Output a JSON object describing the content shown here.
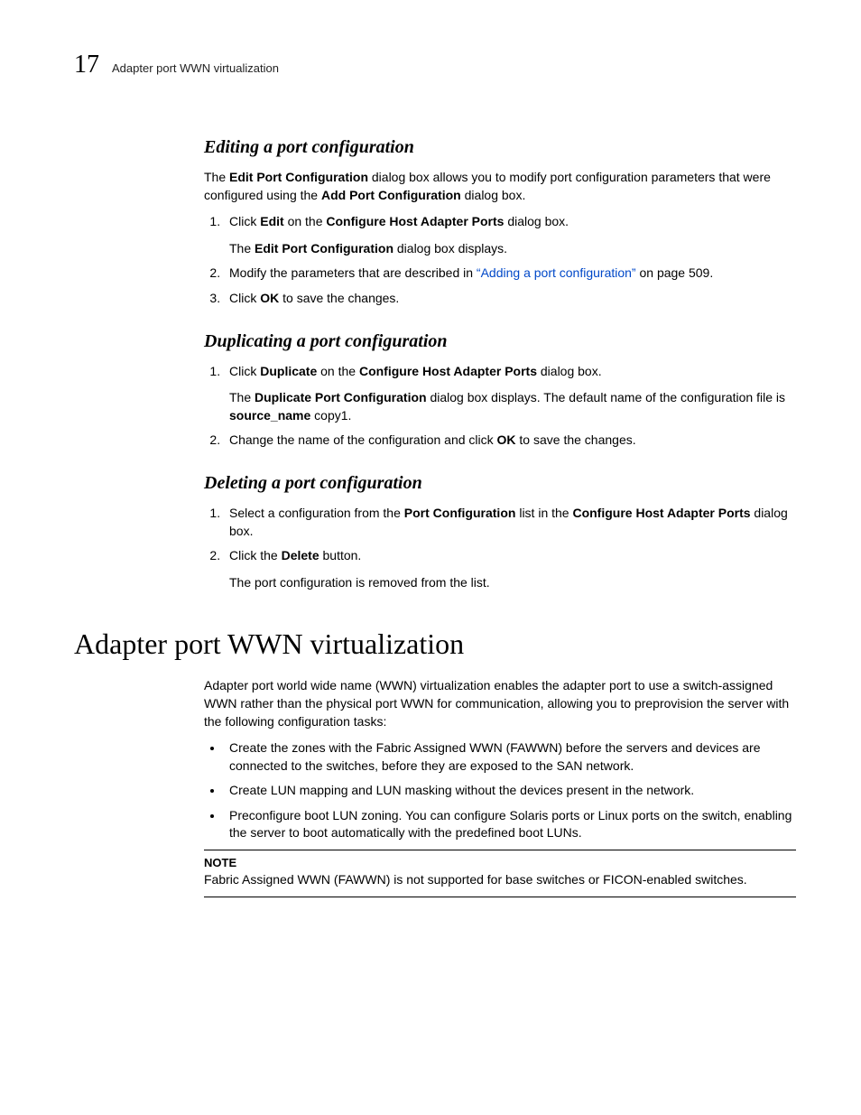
{
  "header": {
    "chapter_number": "17",
    "running_title": "Adapter port WWN virtualization"
  },
  "sec_edit": {
    "title": "Editing a port configuration",
    "intro": {
      "pre1": "The ",
      "b1": "Edit Port Configuration",
      "mid1": " dialog box allows you to modify port configuration parameters that were configured using the ",
      "b2": "Add Port Configuration",
      "post1": " dialog box."
    },
    "step1": {
      "pre": "Click ",
      "b1": "Edit",
      "mid": " on the ",
      "b2": "Configure Host Adapter Ports",
      "post": " dialog box.",
      "sub_pre": "The ",
      "sub_b": "Edit Port Configuration",
      "sub_post": " dialog box displays."
    },
    "step2": {
      "pre": "Modify the parameters that are described in ",
      "link": "“Adding a port configuration”",
      "post": " on page 509."
    },
    "step3": {
      "pre": "Click ",
      "b1": "OK",
      "post": " to save the changes."
    }
  },
  "sec_dup": {
    "title": "Duplicating a port configuration",
    "step1": {
      "pre": "Click ",
      "b1": "Duplicate",
      "mid": " on the ",
      "b2": "Configure Host Adapter Ports",
      "post": " dialog box.",
      "sub_pre": "The ",
      "sub_b1": "Duplicate Port Configuration",
      "sub_mid": " dialog box displays. The default name of the configuration file is ",
      "sub_b2": "source_name",
      "sub_post": " copy1."
    },
    "step2": {
      "pre": "Change the name of the configuration and click ",
      "b1": "OK",
      "post": " to save the changes."
    }
  },
  "sec_del": {
    "title": "Deleting a port configuration",
    "step1": {
      "pre": "Select a configuration from the ",
      "b1": "Port Configuration",
      "mid": " list in the ",
      "b2": "Configure Host Adapter Ports",
      "post": " dialog box."
    },
    "step2": {
      "pre": "Click the ",
      "b1": "Delete",
      "post": " button.",
      "sub": "The port configuration is removed from the list."
    }
  },
  "h1": "Adapter port WWN virtualization",
  "wwn_intro": "Adapter port world wide name (WWN) virtualization enables the adapter port to use a switch-assigned WWN rather than the physical port WWN for communication, allowing you to preprovision the server with the following configuration tasks:",
  "wwn_bullets": {
    "b1": "Create the zones with the Fabric Assigned WWN (FAWWN) before the servers and devices are connected to the switches, before they are exposed to the SAN network.",
    "b2": "Create LUN mapping and LUN masking without the devices present in the network.",
    "b3": "Preconfigure boot LUN zoning. You can configure Solaris ports or Linux ports on the switch, enabling the server to boot automatically with the predefined boot LUNs."
  },
  "note": {
    "label": "NOTE",
    "text": "Fabric Assigned WWN (FAWWN) is not supported for base switches or FICON-enabled switches."
  }
}
